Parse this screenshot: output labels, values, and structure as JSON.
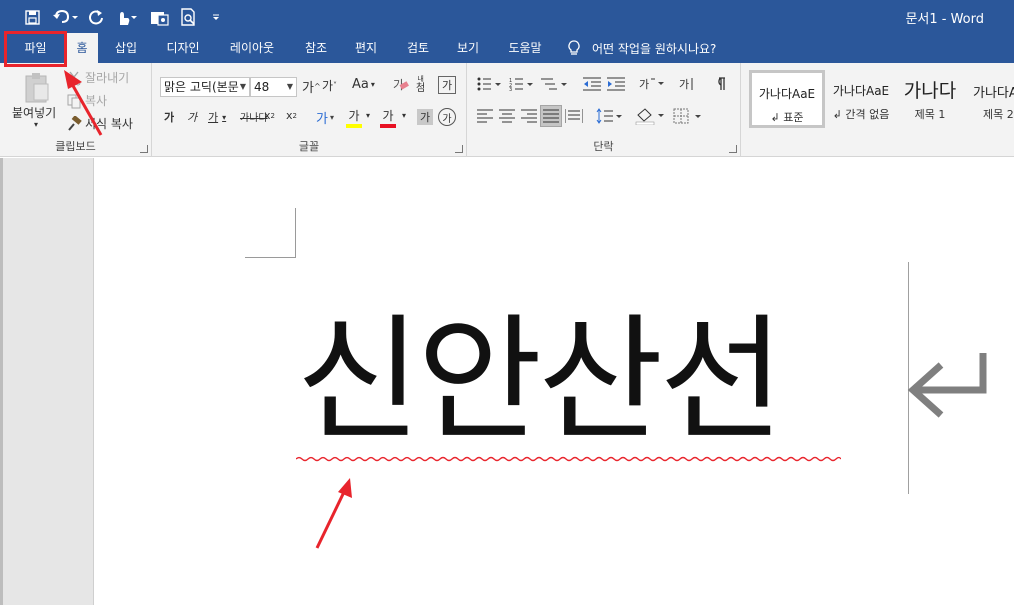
{
  "window": {
    "title": "문서1  -  Word"
  },
  "quick_access": [
    {
      "icon": "save-icon"
    },
    {
      "icon": "undo-icon"
    },
    {
      "icon": "redo-icon"
    },
    {
      "icon": "touch-mode-icon"
    },
    {
      "icon": "clipboard-image-icon"
    },
    {
      "icon": "print-preview-icon"
    },
    {
      "icon": "customize-qat-icon"
    }
  ],
  "tabs": [
    {
      "label": "파일"
    },
    {
      "label": "홈"
    },
    {
      "label": "삽입"
    },
    {
      "label": "디자인"
    },
    {
      "label": "레이아웃"
    },
    {
      "label": "참조"
    },
    {
      "label": "편지"
    },
    {
      "label": "검토"
    },
    {
      "label": "보기"
    },
    {
      "label": "도움말"
    }
  ],
  "tell_me": "어떤 작업을 원하시나요?",
  "clipboard": {
    "paste": "붙여넣기",
    "cut": "잘라내기",
    "copy": "복사",
    "format_painter": "서식 복사",
    "group_label": "클립보드"
  },
  "font": {
    "font_name": "맑은 고딕(본문",
    "font_size": "48",
    "group_label": "글꼴"
  },
  "paragraph": {
    "group_label": "단락"
  },
  "styles": [
    {
      "preview": "가나다AaE",
      "name": "↲ 표준"
    },
    {
      "preview": "가나다AaE",
      "name": "↲ 간격 없음"
    },
    {
      "preview": "가나다",
      "name": "제목 1"
    },
    {
      "preview": "가나다A",
      "name": "제목 2"
    }
  ],
  "document": {
    "text": "신안산선"
  },
  "colors": {
    "accent": "#2b579a",
    "annotation": "#e8242c",
    "highlight_yellow": "#ffff00",
    "font_red": "#e81123"
  }
}
